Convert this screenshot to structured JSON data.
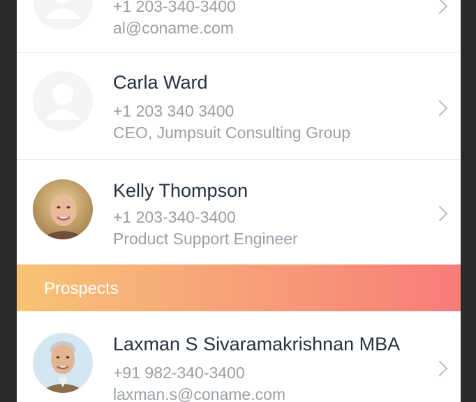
{
  "contacts": [
    {
      "name": "",
      "phone": "+1 203-340-3400",
      "detail": "al@coname.com",
      "avatar_icon": "person-placeholder-icon"
    },
    {
      "name": "Carla Ward",
      "phone": "+1 203 340 3400",
      "detail": "CEO, Jumpsuit Consulting Group",
      "avatar_icon": "person-placeholder-icon"
    },
    {
      "name": "Kelly Thompson",
      "phone": "+1 203-340-3400",
      "detail": "Product Support Engineer",
      "avatar_icon": "photo-avatar"
    }
  ],
  "section": {
    "label": "Prospects"
  },
  "prospects": [
    {
      "name": "Laxman S Sivaramakrishnan MBA",
      "phone": "+91 982-340-3400",
      "detail": "laxman.s@coname.com",
      "avatar_icon": "photo-avatar"
    }
  ],
  "colors": {
    "section_start": "#f8c375",
    "section_end": "#f87c78",
    "name_text": "#26313f",
    "meta_text": "#9a9ea6"
  }
}
